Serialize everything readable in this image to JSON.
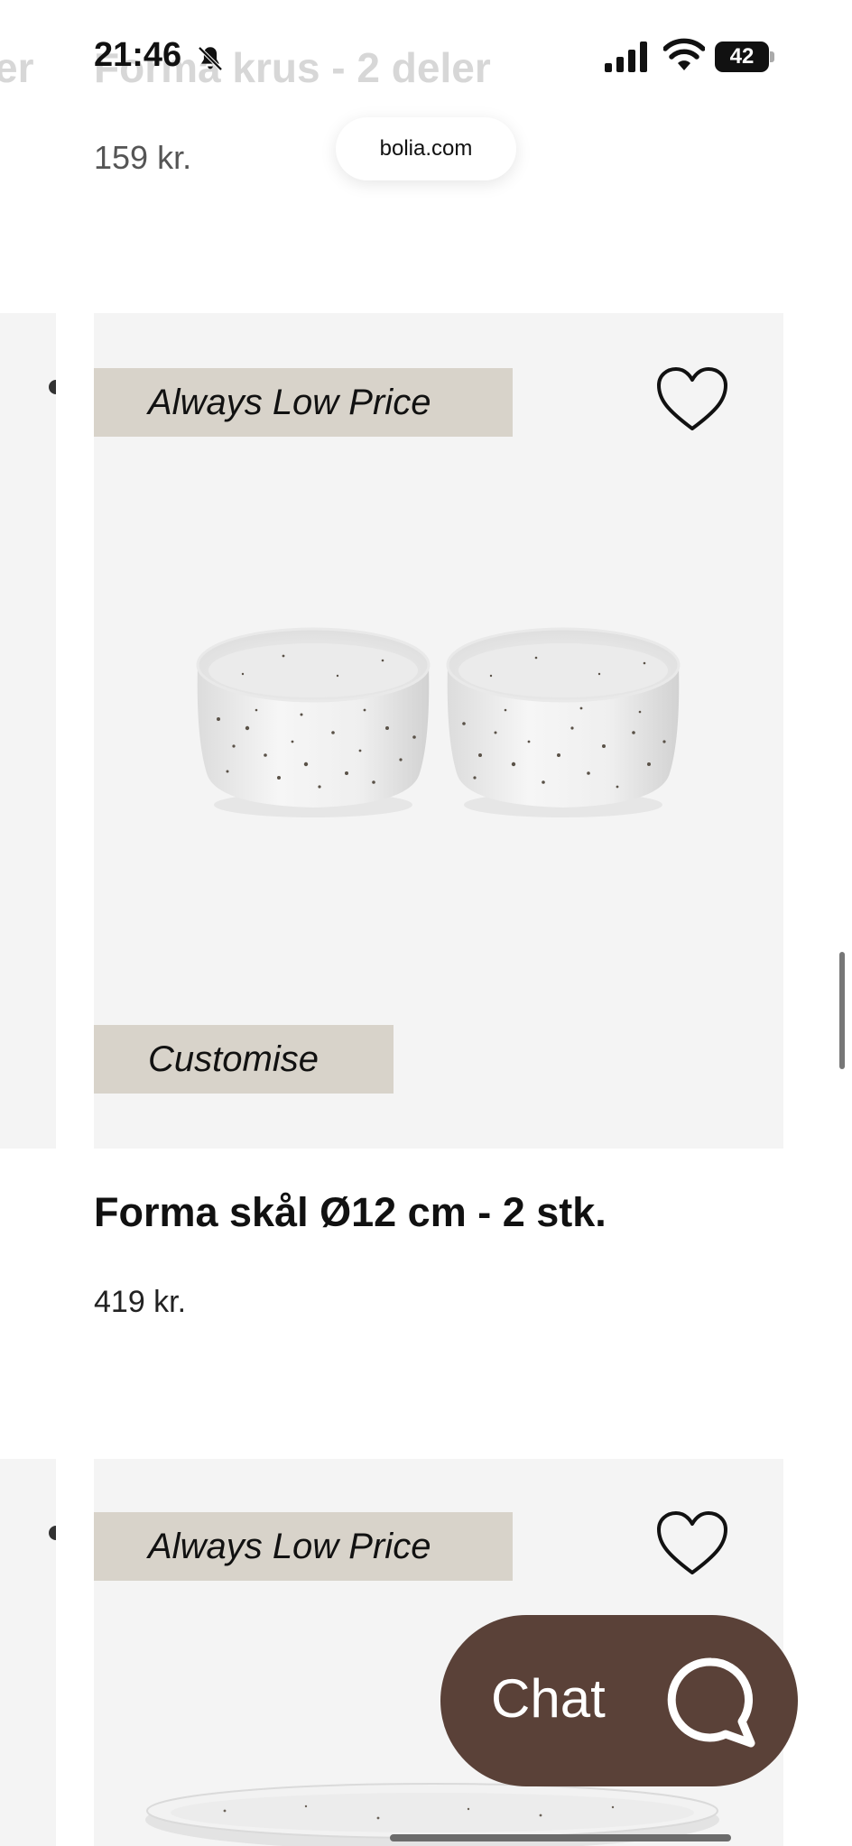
{
  "status_bar": {
    "time": "21:46",
    "battery": "42"
  },
  "browser": {
    "url": "bolia.com"
  },
  "previous_product": {
    "name": "Forma krus - 2 deler",
    "name_fragment": "er",
    "price": "159 kr."
  },
  "products": [
    {
      "badge_top": "Always Low Price",
      "badge_bottom": "Customise",
      "name": "Forma skål Ø12 cm - 2 stk.",
      "price": "419 kr."
    },
    {
      "badge_top": "Always Low Price"
    }
  ],
  "chat": {
    "label": "Chat"
  },
  "colors": {
    "badge_bg": "#d8d3ca",
    "card_bg": "#f4f4f4",
    "chat_bg": "#5a4138"
  }
}
